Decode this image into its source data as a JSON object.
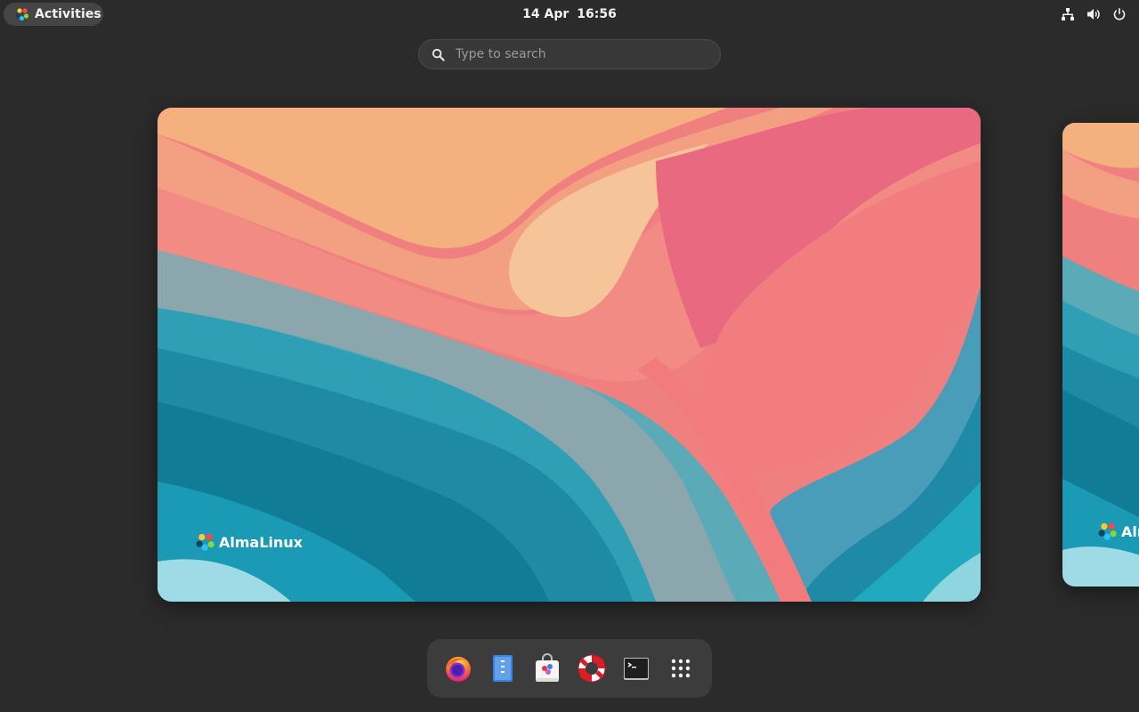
{
  "topbar": {
    "activities_label": "Activities",
    "clock": {
      "date": "14 Apr",
      "time": "16:56"
    },
    "tray_icons": [
      "network-wired-icon",
      "volume-icon",
      "power-icon"
    ]
  },
  "search": {
    "placeholder": "Type to search",
    "value": ""
  },
  "workspaces": [
    {
      "label": "Workspace 1",
      "brand_text": "AlmaLinux"
    },
    {
      "label": "Workspace 2",
      "brand_text": "AlmaLinux"
    }
  ],
  "dash": {
    "items": [
      {
        "icon": "firefox-icon"
      },
      {
        "icon": "text-editor-icon"
      },
      {
        "icon": "software-center-icon"
      },
      {
        "icon": "help-lifebuoy-icon"
      },
      {
        "icon": "terminal-icon"
      },
      {
        "icon": "show-apps-grid-icon"
      }
    ]
  },
  "colors": {
    "panel_bg": "#2b2b2b",
    "dash_bg": "#3c3c3c",
    "wall_pink": "#ef7a80",
    "wall_peach": "#f0a882",
    "wall_teal": "#1e8fa8",
    "wall_grey": "#8aa5ad"
  }
}
